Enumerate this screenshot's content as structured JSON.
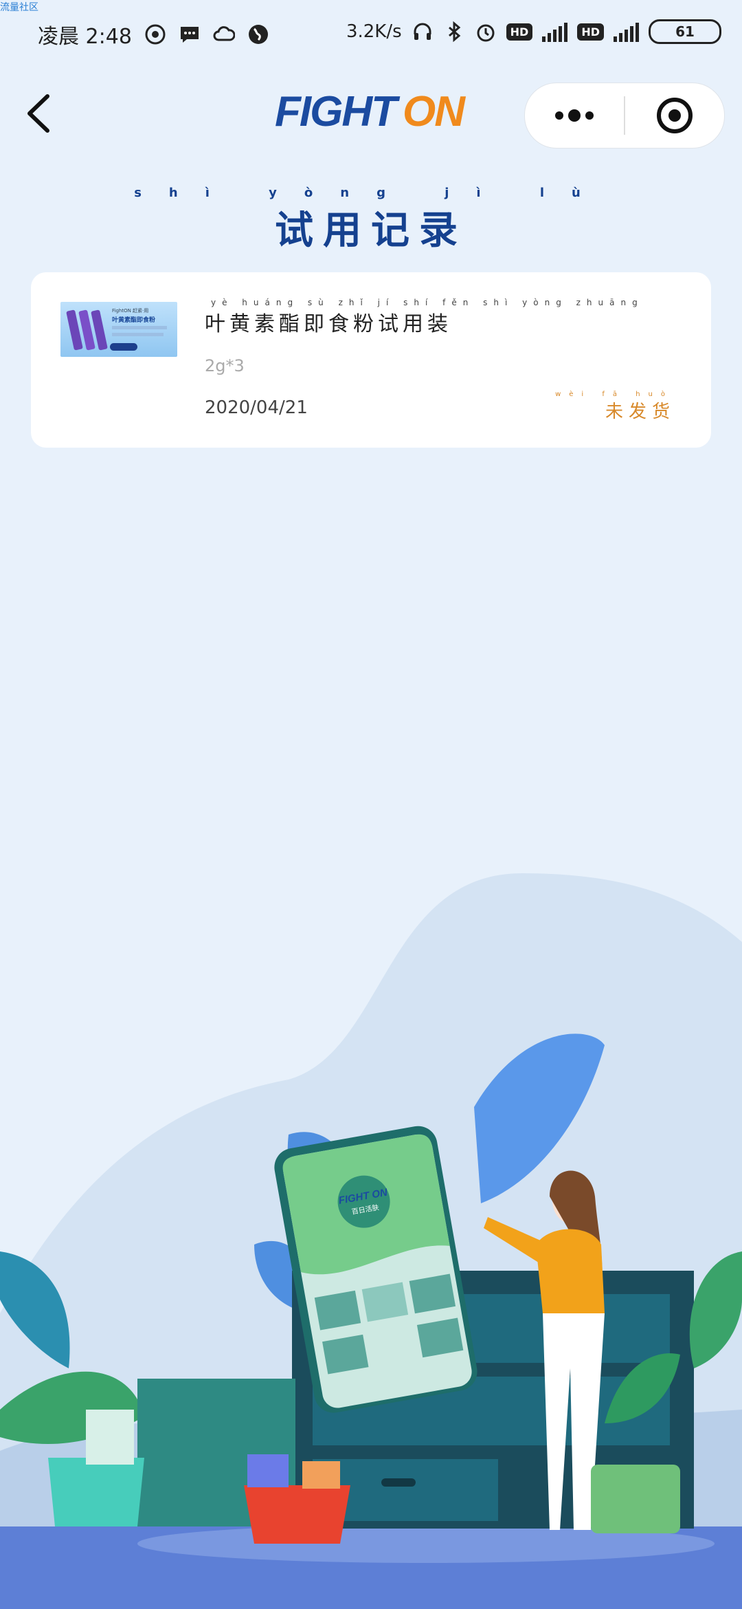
{
  "watermark": "流量社区",
  "status_bar": {
    "time_prefix": "凌晨",
    "time": "2:48",
    "net_speed": "3.2K/s",
    "hd": "HD",
    "net_type": "4G",
    "battery": "61"
  },
  "nav": {
    "logo_part1": "FIGHT",
    "logo_part2": "ON"
  },
  "page": {
    "title": "试用记录",
    "title_pinyin": "shì yòng jì lù"
  },
  "records": [
    {
      "name": "叶黄素酯即食粉试用装",
      "name_pinyin": "yè huáng sù zhǐ jí shí fěn shì yòng zhuāng",
      "spec": "2g*3",
      "date": "2020/04/21",
      "status": "未发货",
      "status_pinyin": "wèi fā huò",
      "thumbnail": {
        "line1": "FightON 赶紧·用",
        "line2": "叶黄素酯即食粉"
      }
    }
  ],
  "illustration": {
    "phone_logo": "FIGHT ON",
    "phone_sub": "百日活肤"
  },
  "colors": {
    "brand_blue": "#1b4ba0",
    "brand_orange": "#f08a1c",
    "status_orange": "#d8892a",
    "background": "#e8f1fb"
  }
}
